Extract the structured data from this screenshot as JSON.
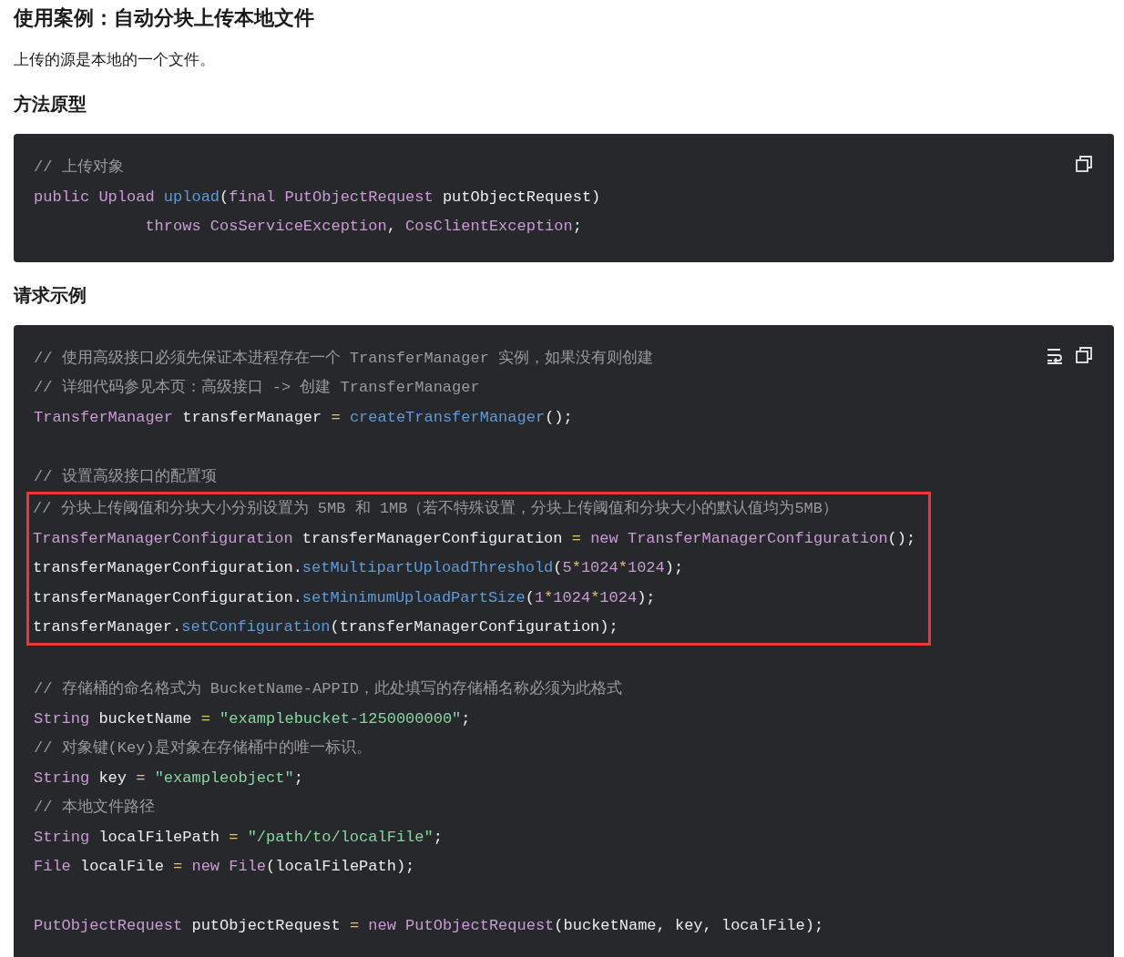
{
  "title": "使用案例：自动分块上传本地文件",
  "intro": "上传的源是本地的一个文件。",
  "sections": [
    {
      "heading": "方法原型",
      "code": {
        "wrap_toggle": false,
        "groups": [
          {
            "highlighted": false,
            "lines": [
              {
                "kind": "code",
                "tokens": [
                  {
                    "text": "// 上传对象",
                    "kind": "comment"
                  }
                ]
              },
              {
                "kind": "code",
                "tokens": [
                  {
                    "text": "public Upload ",
                    "kind": "keyword"
                  },
                  {
                    "text": "upload",
                    "kind": "function"
                  },
                  {
                    "text": "(",
                    "kind": "plain"
                  },
                  {
                    "text": "final PutObjectRequest ",
                    "kind": "keyword"
                  },
                  {
                    "text": "putObjectRequest)",
                    "kind": "plain"
                  }
                ]
              },
              {
                "kind": "code",
                "tokens": [
                  {
                    "text": "            throws CosServiceException",
                    "kind": "keyword"
                  },
                  {
                    "text": ", ",
                    "kind": "plain"
                  },
                  {
                    "text": "CosClientException",
                    "kind": "keyword"
                  },
                  {
                    "text": ";",
                    "kind": "plain"
                  }
                ]
              }
            ]
          }
        ]
      }
    },
    {
      "heading": "请求示例",
      "code": {
        "wrap_toggle": true,
        "groups": [
          {
            "highlighted": false,
            "lines": [
              {
                "kind": "code",
                "tokens": [
                  {
                    "text": "// 使用高级接口必须先保证本进程存在一个 TransferManager 实例，如果没有则创建",
                    "kind": "comment"
                  }
                ]
              },
              {
                "kind": "code",
                "tokens": [
                  {
                    "text": "// 详细代码参见本页：高级接口 -> 创建 TransferManager",
                    "kind": "comment"
                  }
                ]
              },
              {
                "kind": "code",
                "tokens": [
                  {
                    "text": "TransferManager ",
                    "kind": "keyword"
                  },
                  {
                    "text": "transferManager ",
                    "kind": "plain"
                  },
                  {
                    "text": "= ",
                    "kind": "operator"
                  },
                  {
                    "text": "createTransferManager",
                    "kind": "function"
                  },
                  {
                    "text": "();",
                    "kind": "plain"
                  }
                ]
              },
              {
                "kind": "blank"
              },
              {
                "kind": "code",
                "tokens": [
                  {
                    "text": "// 设置高级接口的配置项",
                    "kind": "comment"
                  }
                ]
              }
            ]
          },
          {
            "highlighted": true,
            "lines": [
              {
                "kind": "code",
                "tokens": [
                  {
                    "text": "// 分块上传阈值和分块大小分别设置为 5MB 和 1MB（若不特殊设置，分块上传阈值和分块大小的默认值均为5MB）",
                    "kind": "comment"
                  }
                ]
              },
              {
                "kind": "code",
                "tokens": [
                  {
                    "text": "TransferManagerConfiguration ",
                    "kind": "keyword"
                  },
                  {
                    "text": "transferManagerConfiguration ",
                    "kind": "plain"
                  },
                  {
                    "text": "= ",
                    "kind": "operator"
                  },
                  {
                    "text": "new TransferManagerConfiguration",
                    "kind": "keyword"
                  },
                  {
                    "text": "();",
                    "kind": "plain"
                  }
                ]
              },
              {
                "kind": "code",
                "tokens": [
                  {
                    "text": "transferManagerConfiguration.",
                    "kind": "plain"
                  },
                  {
                    "text": "setMultipartUploadThreshold",
                    "kind": "function"
                  },
                  {
                    "text": "(",
                    "kind": "plain"
                  },
                  {
                    "text": "5",
                    "kind": "number"
                  },
                  {
                    "text": "*",
                    "kind": "operator"
                  },
                  {
                    "text": "1024",
                    "kind": "number"
                  },
                  {
                    "text": "*",
                    "kind": "operator"
                  },
                  {
                    "text": "1024",
                    "kind": "number"
                  },
                  {
                    "text": ");",
                    "kind": "plain"
                  }
                ]
              },
              {
                "kind": "code",
                "tokens": [
                  {
                    "text": "transferManagerConfiguration.",
                    "kind": "plain"
                  },
                  {
                    "text": "setMinimumUploadPartSize",
                    "kind": "function"
                  },
                  {
                    "text": "(",
                    "kind": "plain"
                  },
                  {
                    "text": "1",
                    "kind": "number"
                  },
                  {
                    "text": "*",
                    "kind": "operator"
                  },
                  {
                    "text": "1024",
                    "kind": "number"
                  },
                  {
                    "text": "*",
                    "kind": "operator"
                  },
                  {
                    "text": "1024",
                    "kind": "number"
                  },
                  {
                    "text": ");",
                    "kind": "plain"
                  }
                ]
              },
              {
                "kind": "code",
                "tokens": [
                  {
                    "text": "transferManager.",
                    "kind": "plain"
                  },
                  {
                    "text": "setConfiguration",
                    "kind": "function"
                  },
                  {
                    "text": "(transferManagerConfiguration);",
                    "kind": "plain"
                  }
                ]
              }
            ]
          },
          {
            "highlighted": false,
            "lines": [
              {
                "kind": "blank"
              },
              {
                "kind": "code",
                "tokens": [
                  {
                    "text": "// 存储桶的命名格式为 BucketName-APPID，此处填写的存储桶名称必须为此格式",
                    "kind": "comment"
                  }
                ]
              },
              {
                "kind": "code",
                "tokens": [
                  {
                    "text": "String ",
                    "kind": "keyword"
                  },
                  {
                    "text": "bucketName ",
                    "kind": "plain"
                  },
                  {
                    "text": "= ",
                    "kind": "operator"
                  },
                  {
                    "text": "\"examplebucket-1250000000\"",
                    "kind": "string"
                  },
                  {
                    "text": ";",
                    "kind": "plain"
                  }
                ]
              },
              {
                "kind": "code",
                "tokens": [
                  {
                    "text": "// 对象键(Key)是对象在存储桶中的唯一标识。",
                    "kind": "comment"
                  }
                ]
              },
              {
                "kind": "code",
                "tokens": [
                  {
                    "text": "String ",
                    "kind": "keyword"
                  },
                  {
                    "text": "key ",
                    "kind": "plain"
                  },
                  {
                    "text": "= ",
                    "kind": "operator"
                  },
                  {
                    "text": "\"exampleobject\"",
                    "kind": "string"
                  },
                  {
                    "text": ";",
                    "kind": "plain"
                  }
                ]
              },
              {
                "kind": "code",
                "tokens": [
                  {
                    "text": "// 本地文件路径",
                    "kind": "comment"
                  }
                ]
              },
              {
                "kind": "code",
                "tokens": [
                  {
                    "text": "String ",
                    "kind": "keyword"
                  },
                  {
                    "text": "localFilePath ",
                    "kind": "plain"
                  },
                  {
                    "text": "= ",
                    "kind": "operator"
                  },
                  {
                    "text": "\"/path/to/localFile\"",
                    "kind": "string"
                  },
                  {
                    "text": ";",
                    "kind": "plain"
                  }
                ]
              },
              {
                "kind": "code",
                "tokens": [
                  {
                    "text": "File ",
                    "kind": "keyword"
                  },
                  {
                    "text": "localFile ",
                    "kind": "plain"
                  },
                  {
                    "text": "= ",
                    "kind": "operator"
                  },
                  {
                    "text": "new File",
                    "kind": "keyword"
                  },
                  {
                    "text": "(localFilePath);",
                    "kind": "plain"
                  }
                ]
              },
              {
                "kind": "blank"
              },
              {
                "kind": "code",
                "tokens": [
                  {
                    "text": "PutObjectRequest ",
                    "kind": "keyword"
                  },
                  {
                    "text": "putObjectRequest ",
                    "kind": "plain"
                  },
                  {
                    "text": "= ",
                    "kind": "operator"
                  },
                  {
                    "text": "new PutObjectRequest",
                    "kind": "keyword"
                  },
                  {
                    "text": "(bucketName, key, localFile);",
                    "kind": "plain"
                  }
                ]
              }
            ]
          }
        ]
      }
    }
  ]
}
